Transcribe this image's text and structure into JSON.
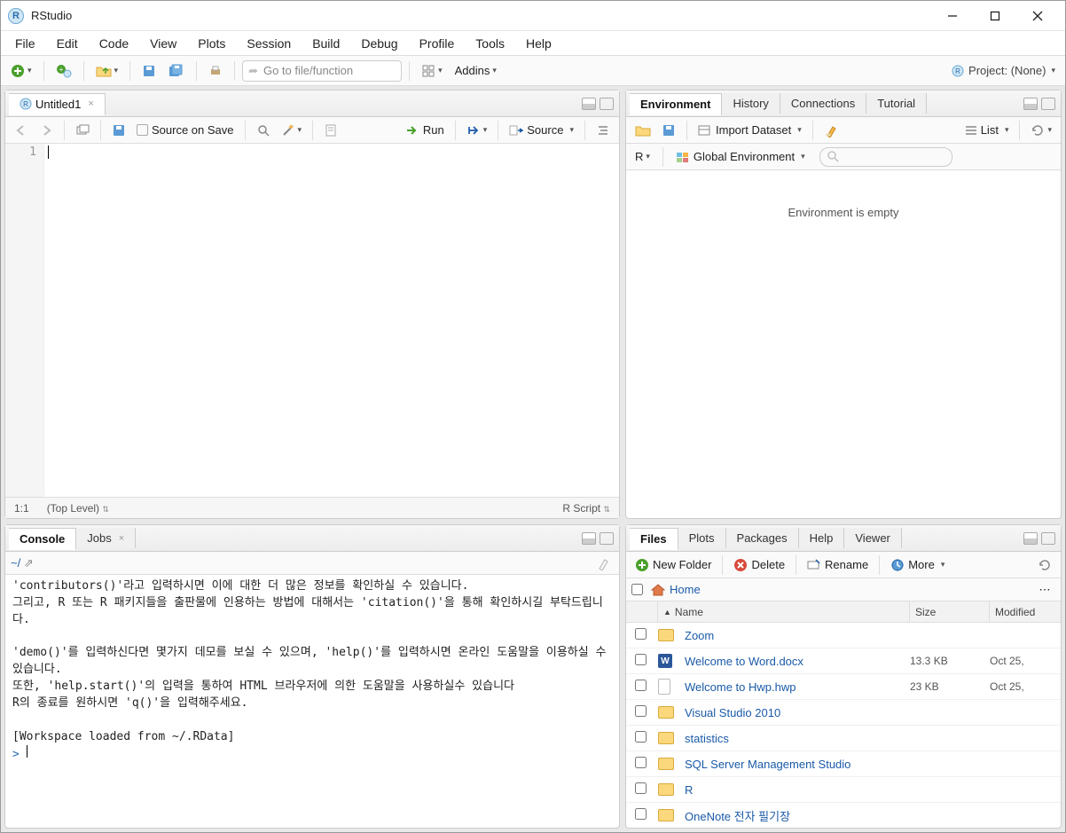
{
  "window": {
    "title": "RStudio"
  },
  "menu": [
    "File",
    "Edit",
    "Code",
    "View",
    "Plots",
    "Session",
    "Build",
    "Debug",
    "Profile",
    "Tools",
    "Help"
  ],
  "toolbar": {
    "goto_placeholder": "Go to file/function",
    "addins": "Addins",
    "project": "Project: (None)"
  },
  "source": {
    "tab": "Untitled1",
    "source_on_save": "Source on Save",
    "run": "Run",
    "source_btn": "Source",
    "line_no": "1",
    "pos": "1:1",
    "top_level": "(Top Level)",
    "type": "R Script"
  },
  "env_pane": {
    "tabs": [
      "Environment",
      "History",
      "Connections",
      "Tutorial"
    ],
    "import": "Import Dataset",
    "list": "List",
    "r_label": "R",
    "global": "Global Environment",
    "empty": "Environment is empty"
  },
  "console_pane": {
    "tabs": [
      "Console",
      "Jobs"
    ],
    "path": "~/",
    "text": "'contributors()'라고 입력하시면 이에 대한 더 많은 정보를 확인하실 수 있습니다.\n그리고, R 또는 R 패키지들을 출판물에 인용하는 방법에 대해서는 'citation()'을 통해 확인하시길 부탁드립니다.\n\n'demo()'를 입력하신다면 몇가지 데모를 보실 수 있으며, 'help()'를 입력하시면 온라인 도움말을 이용하실 수 있습니다.\n또한, 'help.start()'의 입력을 통하여 HTML 브라우저에 의한 도움말을 사용하실수 있습니다\nR의 종료를 원하시면 'q()'을 입력해주세요.\n\n[Workspace loaded from ~/.RData]\n",
    "prompt": "> "
  },
  "files_pane": {
    "tabs": [
      "Files",
      "Plots",
      "Packages",
      "Help",
      "Viewer"
    ],
    "new_folder": "New Folder",
    "delete": "Delete",
    "rename": "Rename",
    "more": "More",
    "home": "Home",
    "cols": {
      "name": "Name",
      "size": "Size",
      "modified": "Modified"
    },
    "rows": [
      {
        "icon": "folder",
        "name": "Zoom",
        "size": "",
        "date": ""
      },
      {
        "icon": "word",
        "name": "Welcome to Word.docx",
        "size": "13.3 KB",
        "date": "Oct 25,"
      },
      {
        "icon": "file",
        "name": "Welcome to Hwp.hwp",
        "size": "23 KB",
        "date": "Oct 25,"
      },
      {
        "icon": "folder",
        "name": "Visual Studio 2010",
        "size": "",
        "date": ""
      },
      {
        "icon": "folder",
        "name": "statistics",
        "size": "",
        "date": ""
      },
      {
        "icon": "folder",
        "name": "SQL Server Management Studio",
        "size": "",
        "date": ""
      },
      {
        "icon": "folder",
        "name": "R",
        "size": "",
        "date": ""
      },
      {
        "icon": "folder",
        "name": "OneNote 전자 필기장",
        "size": "",
        "date": ""
      }
    ]
  }
}
